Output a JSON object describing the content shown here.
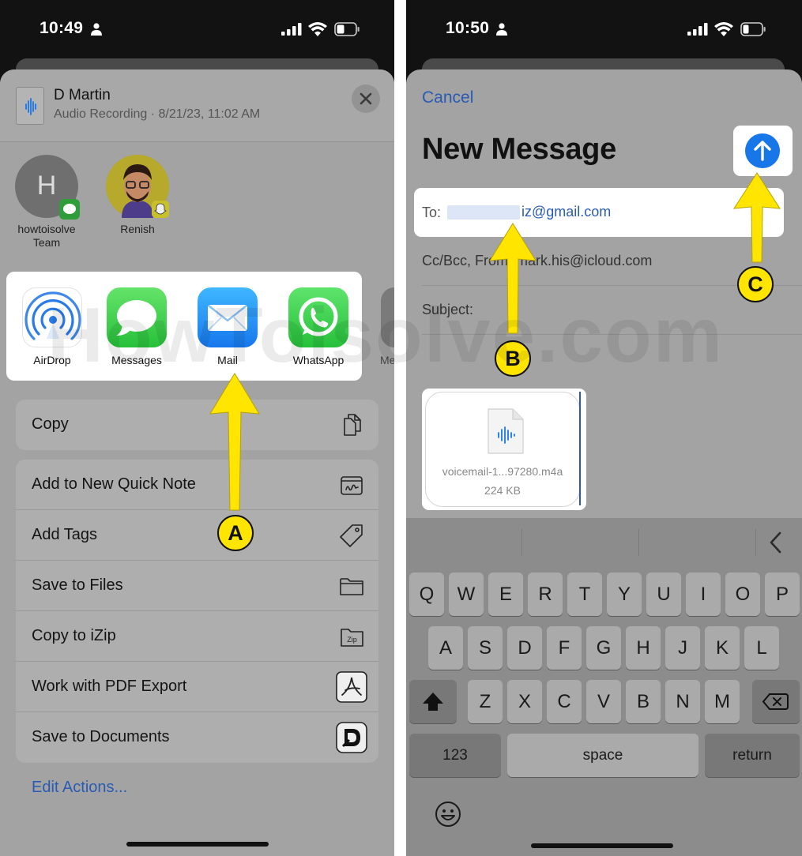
{
  "left": {
    "status_time": "10:49",
    "file": {
      "name": "D Martin",
      "meta": "Audio Recording · 8/21/23, 11:02 AM"
    },
    "contacts": [
      {
        "initial": "H",
        "label_line1": "howtoisolve",
        "label_line2": "Team"
      },
      {
        "label_line1": "Renish"
      }
    ],
    "apps": [
      {
        "label": "AirDrop",
        "icon": "airdrop-icon"
      },
      {
        "label": "Messages",
        "icon": "messages-icon"
      },
      {
        "label": "Mail",
        "icon": "mail-icon"
      },
      {
        "label": "WhatsApp",
        "icon": "whatsapp-icon"
      },
      {
        "label": "Me"
      }
    ],
    "copy_label": "Copy",
    "actions": [
      {
        "label": "Add to New Quick Note",
        "icon": "quick-note-icon"
      },
      {
        "label": "Add Tags",
        "icon": "tag-icon"
      },
      {
        "label": "Save to Files",
        "icon": "folder-icon"
      },
      {
        "label": "Copy to iZip",
        "icon": "zip-icon",
        "icon_text": "Zip"
      },
      {
        "label": "Work with PDF Export",
        "icon": "pdf-export-icon"
      },
      {
        "label": "Save to Documents",
        "icon": "documents-icon"
      }
    ],
    "edit_actions": "Edit Actions...",
    "watermark": "HowToisolve.com"
  },
  "right": {
    "status_time": "10:50",
    "cancel": "Cancel",
    "title": "New Message",
    "to_label": "To:",
    "to_value": "iz@gmail.com",
    "ccbcc": "Cc/Bcc, From: mark.his@icloud.com",
    "subject": "Subject:",
    "attachment": {
      "name": "voicemail-1...97280.m4a",
      "size": "224 KB"
    },
    "keyboard": {
      "row1": [
        "Q",
        "W",
        "E",
        "R",
        "T",
        "Y",
        "U",
        "I",
        "O",
        "P"
      ],
      "row2": [
        "A",
        "S",
        "D",
        "F",
        "G",
        "H",
        "J",
        "K",
        "L"
      ],
      "row3": [
        "Z",
        "X",
        "C",
        "V",
        "B",
        "N",
        "M"
      ],
      "numbers": "123",
      "space": "space",
      "return": "return"
    }
  },
  "annotations": {
    "a": "A",
    "b": "B",
    "c": "C"
  },
  "colors": {
    "accent_blue": "#1877e8",
    "link_blue": "#2a5bb3",
    "annotation_yellow": "#ffe500"
  }
}
